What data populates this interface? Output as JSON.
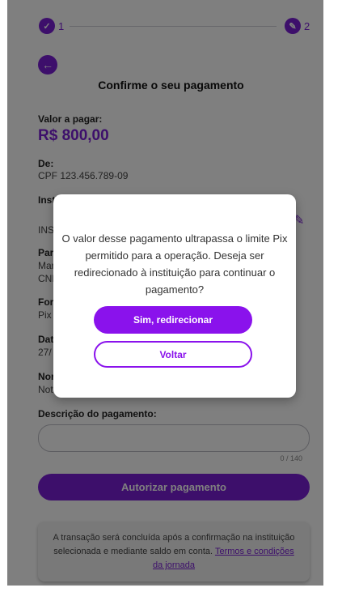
{
  "stepper": {
    "step1": "1",
    "step2": "2",
    "step1_icon": "check-icon",
    "step2_icon": "pencil-icon"
  },
  "header": {
    "back_icon": "arrow-left-icon",
    "title": "Confirme o seu pagamento"
  },
  "details": {
    "amount_label": "Valor a pagar:",
    "amount_value": "R$ 800,00",
    "from_label": "De:",
    "from_value": "CPF 123.456.789-09",
    "institution_label": "Insti",
    "institution_value": "INS",
    "payee_label": "Par",
    "payee_value_1": "Mar",
    "payee_value_2": "CNI",
    "method_label": "For",
    "method_value": "Pix",
    "date_label": "Dat",
    "date_value": "27/",
    "name_label": "Nor",
    "name_value": "Not",
    "description_label": "Descrição do pagamento:",
    "description_value": "",
    "counter": "0 / 140"
  },
  "authorize_button": "Autorizar pagamento",
  "info": {
    "text": "A transação será concluída após a confirmação na instituição selecionada e mediante saldo em conta.",
    "link": "Termos e condições da jornada"
  },
  "modal": {
    "message": "O valor desse pagamento ultrapassa o limite Pix permitido para a operação. Deseja ser redirecionado à instituição para continuar o pagamento?",
    "primary_button": "Sim, redirecionar",
    "secondary_button": "Voltar"
  },
  "colors": {
    "accent": "#7a1fd6",
    "button_primary": "#8a12ec"
  }
}
